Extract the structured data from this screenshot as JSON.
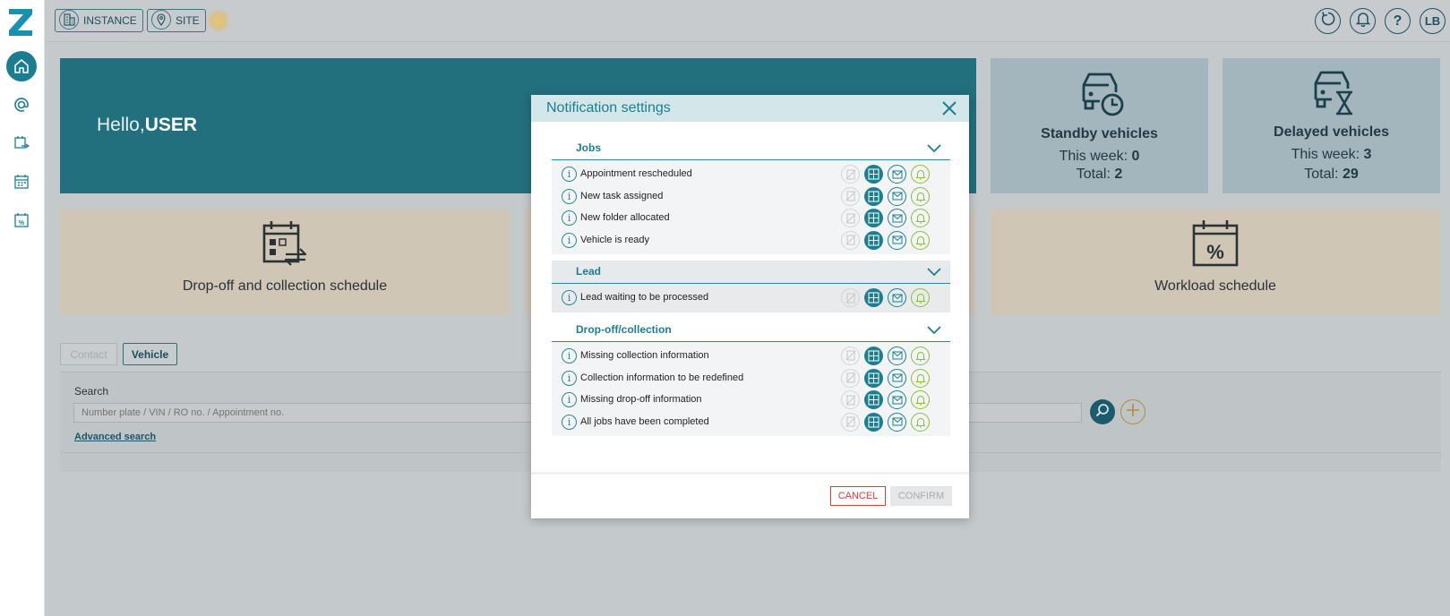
{
  "topbar": {
    "instance_label": "INSTANCE",
    "site_label": "SITE",
    "user_initials": "LB"
  },
  "banner": {
    "greeting": "Hello,",
    "user": "USER"
  },
  "standby": {
    "title": "Standby vehicles",
    "week_label": "This week:",
    "week_value": "0",
    "total_label": "Total:",
    "total_value": "2"
  },
  "delayed": {
    "title": "Delayed vehicles",
    "week_label": "This week:",
    "week_value": "3",
    "total_label": "Total:",
    "total_value": "29"
  },
  "tiles": {
    "dropoff": "Drop-off and collection schedule",
    "workload": "Workload schedule"
  },
  "search": {
    "tab_contact": "Contact",
    "tab_vehicle": "Vehicle",
    "label": "Search",
    "placeholder": "Number plate / VIN / RO no. / Appointment no.",
    "advanced": "Advanced search"
  },
  "modal": {
    "title": "Notification settings",
    "sections": [
      {
        "title": "Jobs",
        "rows": [
          "Appointment rescheduled",
          "New task assigned",
          "New folder allocated",
          "Vehicle is ready"
        ]
      },
      {
        "title": "Lead",
        "rows": [
          "Lead waiting to be processed"
        ]
      },
      {
        "title": "Drop-off/collection",
        "rows": [
          "Missing collection information",
          "Collection information to be redefined",
          "Missing drop-off information",
          "All jobs have been completed"
        ]
      }
    ],
    "cancel": "CANCEL",
    "confirm": "CONFIRM"
  },
  "colors": {
    "accent": "#1b7f8f",
    "banner": "#226f7d",
    "cancel": "#d5403a",
    "bell": "#8bbf3a"
  }
}
